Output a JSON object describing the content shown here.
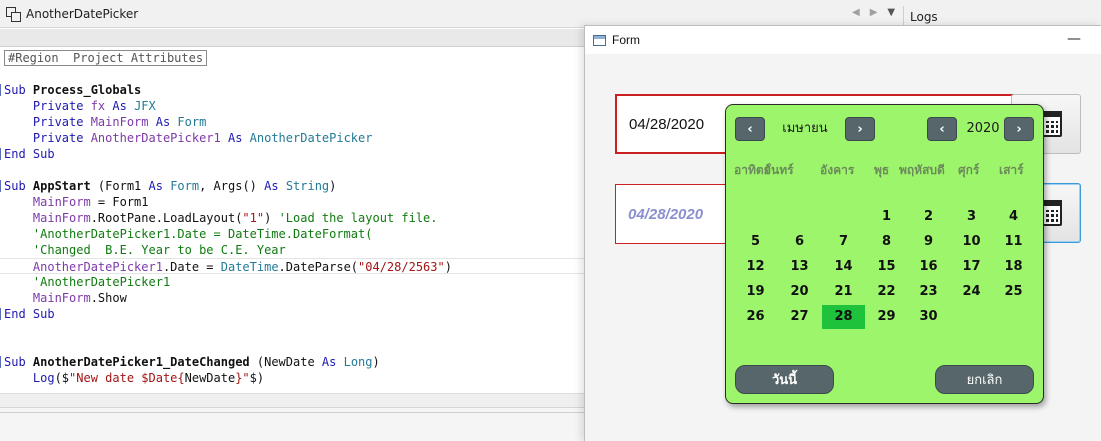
{
  "ide": {
    "tab_title": "AnotherDatePicker",
    "logs_tab": "Logs",
    "code_lines": [
      {
        "type": "region",
        "text": "#Region  Project Attributes"
      },
      {
        "type": "blank"
      },
      {
        "type": "code",
        "gutter": true,
        "parts": [
          [
            "kw",
            "Sub "
          ],
          [
            "bold",
            "Process_Globals"
          ]
        ]
      },
      {
        "type": "code",
        "parts": [
          [
            "kw",
            "    Private "
          ],
          [
            "var",
            "fx"
          ],
          [
            "kw",
            " As "
          ],
          [
            "type",
            "JFX"
          ]
        ]
      },
      {
        "type": "code",
        "parts": [
          [
            "kw",
            "    Private "
          ],
          [
            "var",
            "MainForm"
          ],
          [
            "kw",
            " As "
          ],
          [
            "type",
            "Form"
          ]
        ]
      },
      {
        "type": "code",
        "parts": [
          [
            "kw",
            "    Private "
          ],
          [
            "var",
            "AnotherDatePicker1"
          ],
          [
            "kw",
            " As "
          ],
          [
            "type",
            "AnotherDatePicker"
          ]
        ]
      },
      {
        "type": "code",
        "gutter": true,
        "parts": [
          [
            "kw",
            "End Sub"
          ]
        ]
      },
      {
        "type": "blank"
      },
      {
        "type": "code",
        "gutter": true,
        "parts": [
          [
            "kw",
            "Sub "
          ],
          [
            "bold",
            "AppStart"
          ],
          [
            "plain",
            " (Form1 "
          ],
          [
            "kw",
            "As "
          ],
          [
            "type",
            "Form"
          ],
          [
            "plain",
            ", Args() "
          ],
          [
            "kw",
            "As "
          ],
          [
            "type",
            "String"
          ],
          [
            "plain",
            ")"
          ]
        ]
      },
      {
        "type": "code",
        "parts": [
          [
            "var",
            "    MainForm"
          ],
          [
            "plain",
            " = Form1"
          ]
        ]
      },
      {
        "type": "code",
        "parts": [
          [
            "var",
            "    MainForm"
          ],
          [
            "plain",
            ".RootPane.LoadLayout("
          ],
          [
            "str",
            "\"1\""
          ],
          [
            "plain",
            ") "
          ],
          [
            "cmt",
            "'Load the layout file."
          ]
        ]
      },
      {
        "type": "code",
        "parts": [
          [
            "cmt",
            "    'AnotherDatePicker1.Date = DateTime.DateFormat("
          ]
        ]
      },
      {
        "type": "code",
        "parts": [
          [
            "cmt",
            "    'Changed  B.E. Year to be C.E. Year"
          ]
        ]
      },
      {
        "type": "code",
        "current": true,
        "parts": [
          [
            "var",
            "    AnotherDatePicker1"
          ],
          [
            "plain",
            ".Date = "
          ],
          [
            "type",
            "DateTime"
          ],
          [
            "plain",
            ".DateParse("
          ],
          [
            "str",
            "\"04/28/2563\""
          ],
          [
            "plain",
            ")"
          ]
        ]
      },
      {
        "type": "code",
        "parts": [
          [
            "cmt",
            "    'AnotherDatePicker1"
          ]
        ]
      },
      {
        "type": "code",
        "parts": [
          [
            "var",
            "    MainForm"
          ],
          [
            "plain",
            ".Show"
          ]
        ]
      },
      {
        "type": "code",
        "gutter": true,
        "parts": [
          [
            "kw",
            "End Sub"
          ]
        ]
      },
      {
        "type": "blank"
      },
      {
        "type": "blank"
      },
      {
        "type": "code",
        "gutter": true,
        "parts": [
          [
            "kw",
            "Sub "
          ],
          [
            "bold",
            "AnotherDatePicker1_DateChanged"
          ],
          [
            "plain",
            " (NewDate "
          ],
          [
            "kw",
            "As "
          ],
          [
            "type",
            "Long"
          ],
          [
            "plain",
            ")"
          ]
        ]
      },
      {
        "type": "code",
        "parts": [
          [
            "kw",
            "    Log"
          ],
          [
            "plain",
            "($"
          ],
          [
            "str",
            "\"New date $Date{"
          ],
          [
            "plain",
            "NewDate"
          ],
          [
            "str",
            "}\""
          ],
          [
            "plain",
            "$)"
          ]
        ]
      }
    ]
  },
  "form": {
    "title": "Form",
    "minimize_glyph": "—",
    "date_field_1": "04/28/2020",
    "date_field_2": "04/28/2020"
  },
  "calendar": {
    "prev_glyph": "‹",
    "next_glyph": "›",
    "month": "เมษายน",
    "year": "2020",
    "weekdays": [
      "อาทิตย์",
      "จันทร์",
      "อังคาร",
      "พุธ",
      "พฤหัสบดี",
      "ศุกร์",
      "เสาร์"
    ],
    "weeks": [
      [
        "",
        "",
        "",
        "1",
        "2",
        "3",
        "4"
      ],
      [
        "5",
        "6",
        "7",
        "8",
        "9",
        "10",
        "11"
      ],
      [
        "12",
        "13",
        "14",
        "15",
        "16",
        "17",
        "18"
      ],
      [
        "19",
        "20",
        "21",
        "22",
        "23",
        "24",
        "25"
      ],
      [
        "26",
        "27",
        "28",
        "29",
        "30",
        "",
        ""
      ]
    ],
    "selected_day": "28",
    "today_button": "วันนี้",
    "cancel_button": "ยกเลิก",
    "colors": {
      "background": "#9df56c",
      "selected_day": "#1fc23b",
      "button": "#56666a",
      "weekday_text": "#6b8b5a"
    }
  }
}
